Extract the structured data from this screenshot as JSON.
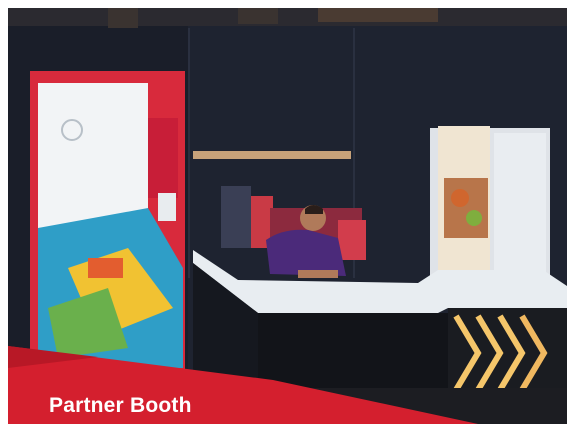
{
  "caption": "Partner Booth",
  "colors": {
    "wall": "#1f2430",
    "counter_top": "#e9eef2",
    "banner_red": "#d8203a",
    "caption_band": "#d41f2e",
    "led": "#f5c66a"
  }
}
